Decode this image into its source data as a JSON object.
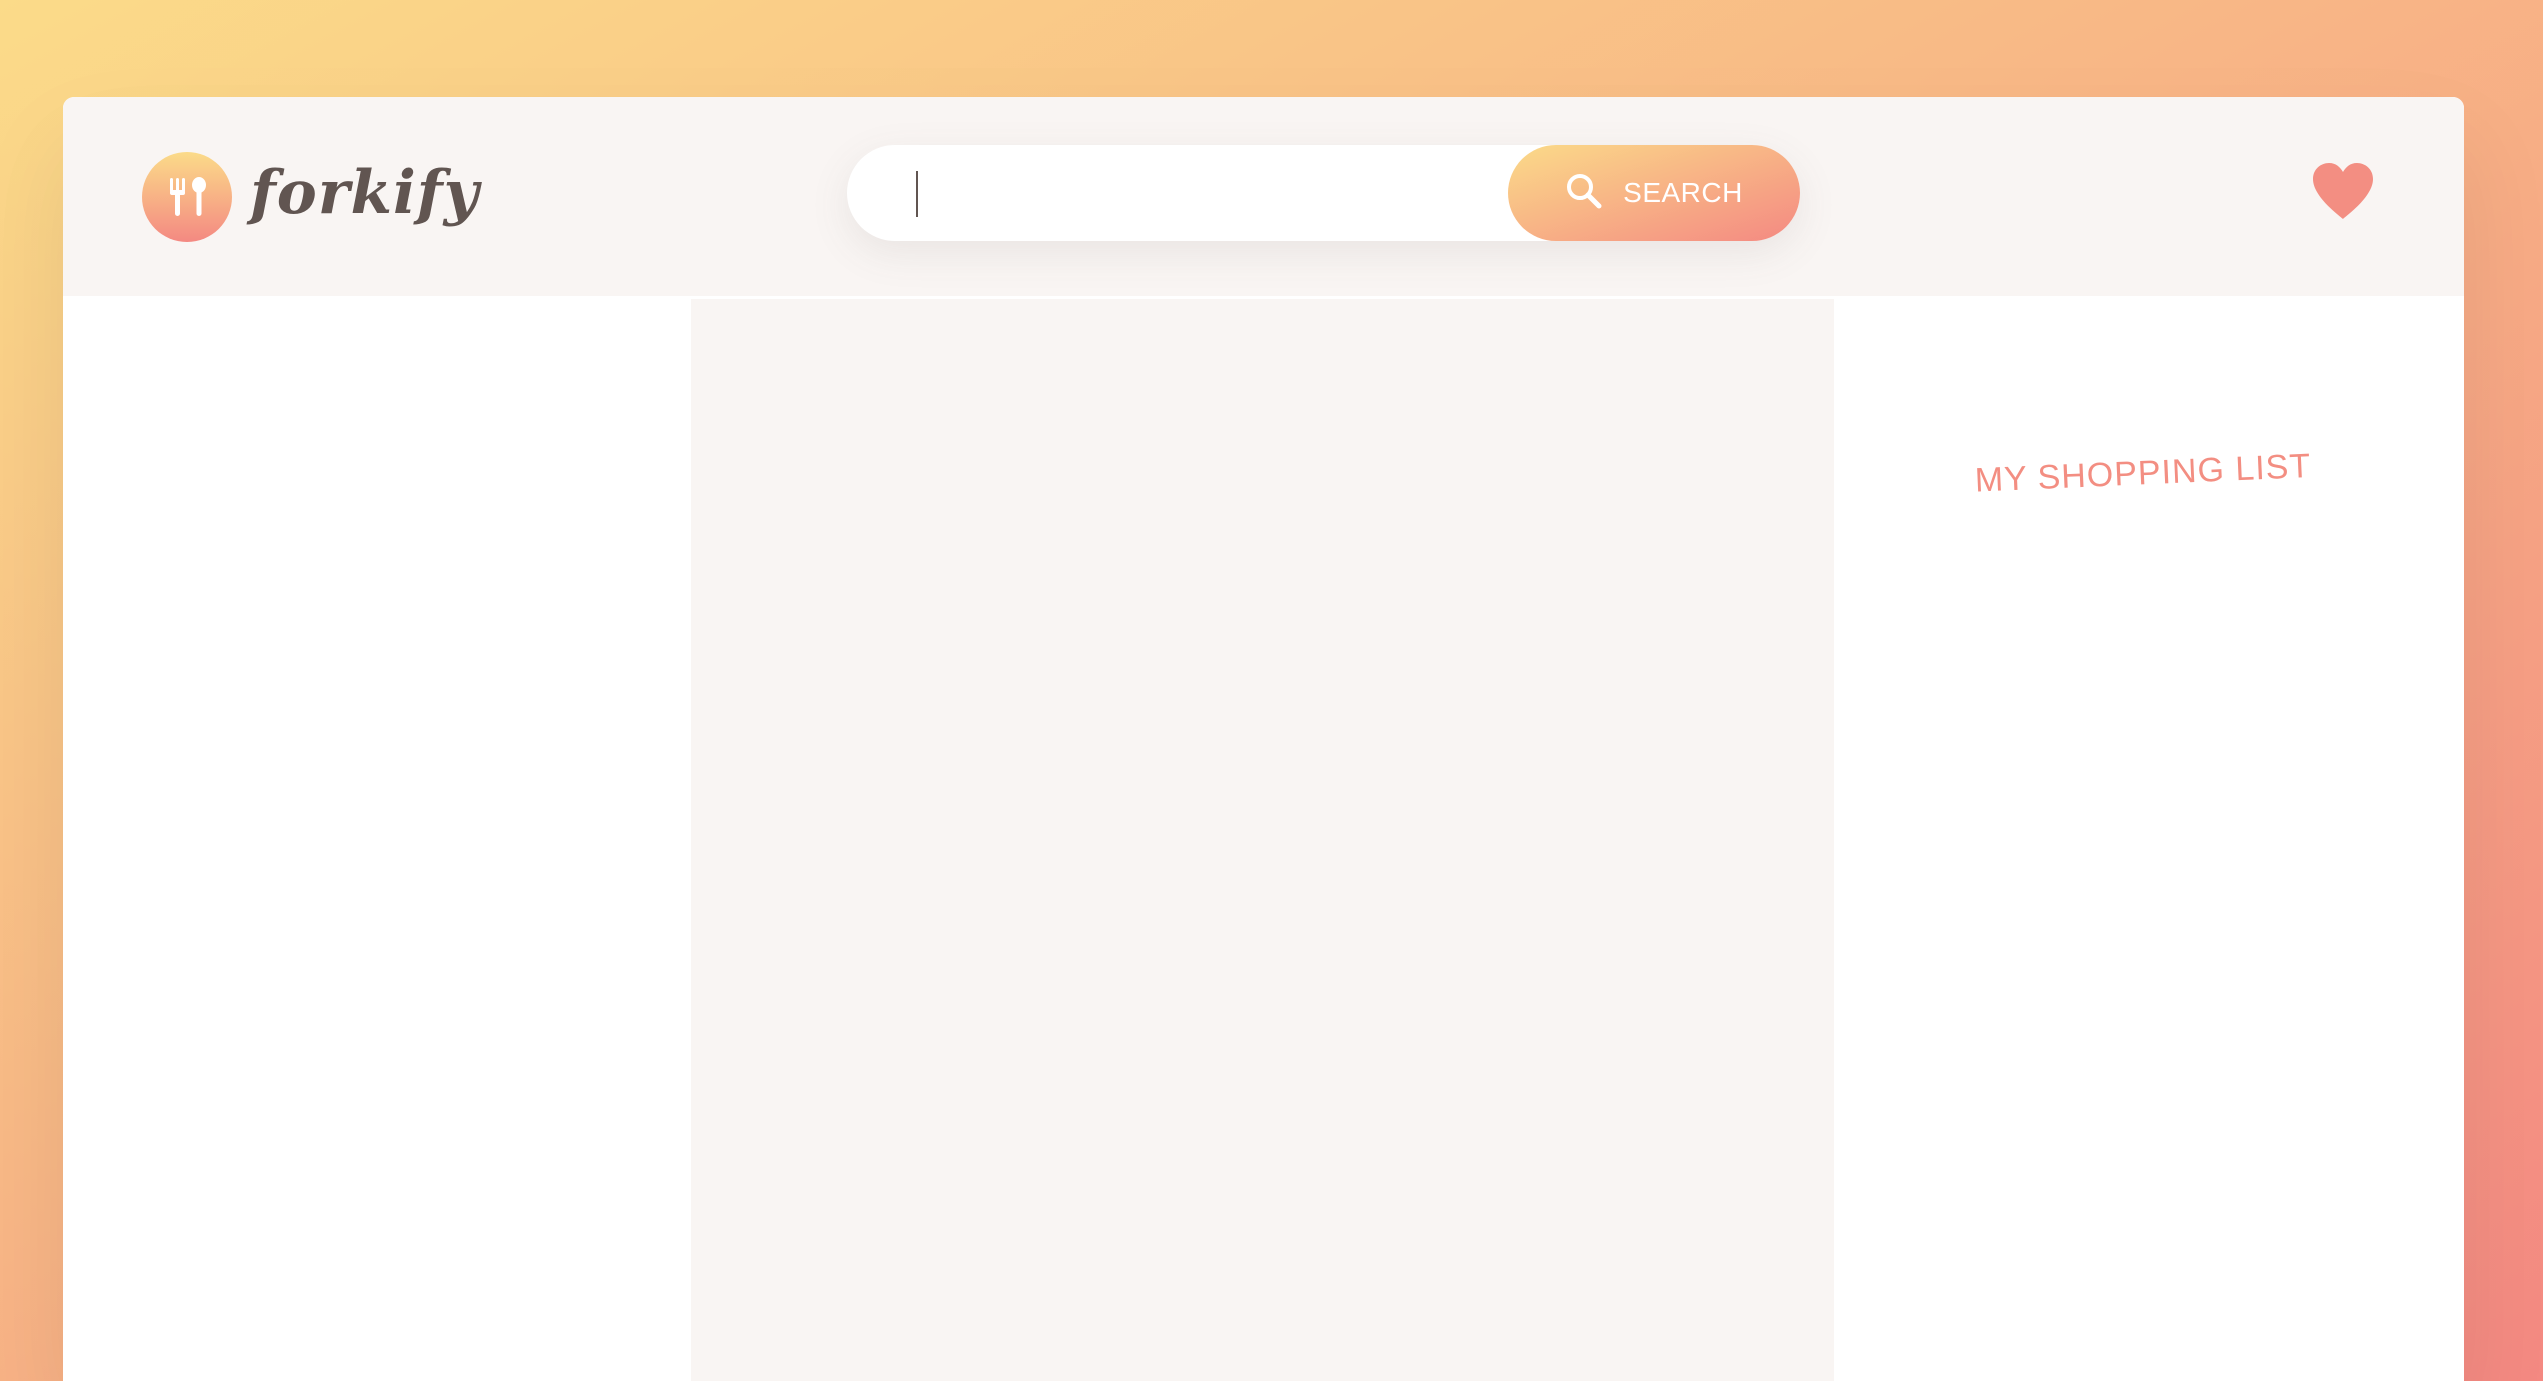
{
  "header": {
    "logo_text": "forkify",
    "logo_icon": "fork-and-spoon-icon",
    "search": {
      "value": "",
      "placeholder": "",
      "button_label": "SEARCH",
      "button_icon": "search-icon"
    },
    "bookmarks_icon": "heart-icon"
  },
  "shopping_list": {
    "title": "MY SHOPPING LIST"
  },
  "colors": {
    "gradient_start": "#fbdb89",
    "gradient_end": "#f48982",
    "accent": "#f38e82",
    "header_bg": "#f9f5f3",
    "text_dark": "#615551"
  }
}
